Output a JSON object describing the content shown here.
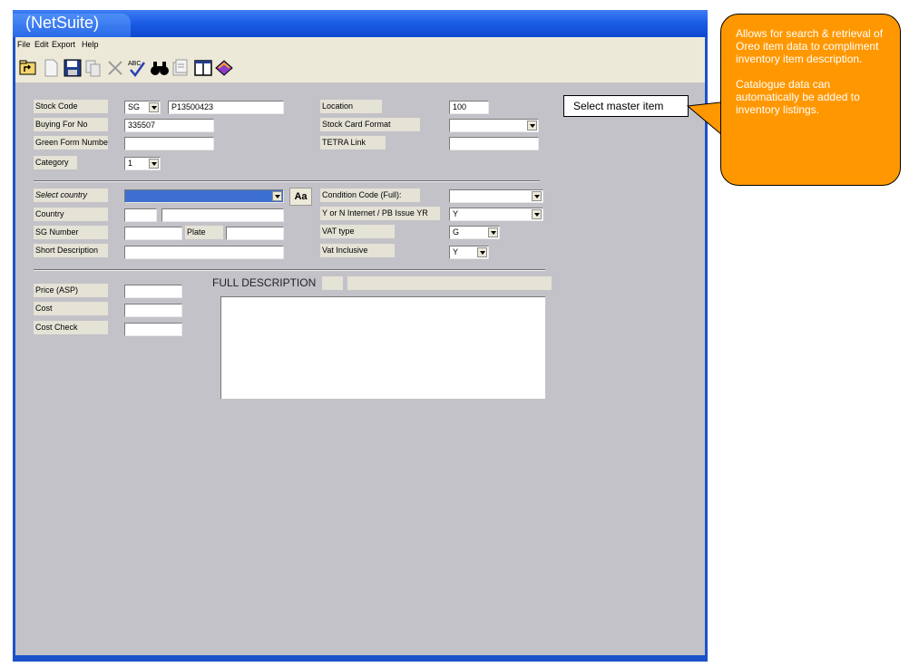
{
  "window": {
    "title": "(NetSuite)",
    "menu": [
      "File",
      "Edit",
      "Export",
      "Help"
    ],
    "toolbar_icons": [
      "folder-up-icon",
      "new-document-icon",
      "save-disk-icon",
      "copy-icon",
      "delete-x-icon",
      "spellcheck-icon",
      "binoculars-icon",
      "properties-icon",
      "columns-icon",
      "book-icon"
    ]
  },
  "form": {
    "stock_code": {
      "label": "Stock Code",
      "prefix": "SG",
      "value": "P13500423"
    },
    "buying_for_no": {
      "label": "Buying For No",
      "value": "335507"
    },
    "green_form_number": {
      "label": "Green Form Number",
      "value": ""
    },
    "category": {
      "label": "Category",
      "value": "1"
    },
    "location": {
      "label": "Location",
      "value": "100"
    },
    "stock_card_format": {
      "label": "Stock Card Format",
      "value": ""
    },
    "tetra_link": {
      "label": "TETRA Link",
      "value": ""
    },
    "select_country": {
      "label": "Select country",
      "value": ""
    },
    "aa_button": "Aa",
    "country": {
      "label": "Country",
      "code": "",
      "value": ""
    },
    "sg_number": {
      "label": "SG Number",
      "value": "",
      "plate_label": "Plate",
      "plate_value": ""
    },
    "short_description": {
      "label": "Short Description",
      "value": ""
    },
    "condition_code": {
      "label": "Condition Code (Full):",
      "value": ""
    },
    "internet_issue": {
      "label": "Y or N Internet / PB Issue YR",
      "value": "Y"
    },
    "vat_type": {
      "label": "VAT type",
      "value": "G"
    },
    "vat_inclusive": {
      "label": "Vat Inclusive",
      "value": "Y"
    },
    "price_asp": {
      "label": "Price (ASP)",
      "value": ""
    },
    "cost": {
      "label": "Cost",
      "value": ""
    },
    "cost_check": {
      "label": "Cost Check",
      "value": ""
    },
    "full_description": {
      "title": "FULL DESCRIPTION",
      "value": ""
    }
  },
  "master_button": "Select master item",
  "callout": {
    "paragraph1": "Allows for search & retrieval of Oreo item data to compliment inventory item description.",
    "paragraph2": "Catalogue data can automatically be added to inventory listings.",
    "color": "#ff9800"
  }
}
